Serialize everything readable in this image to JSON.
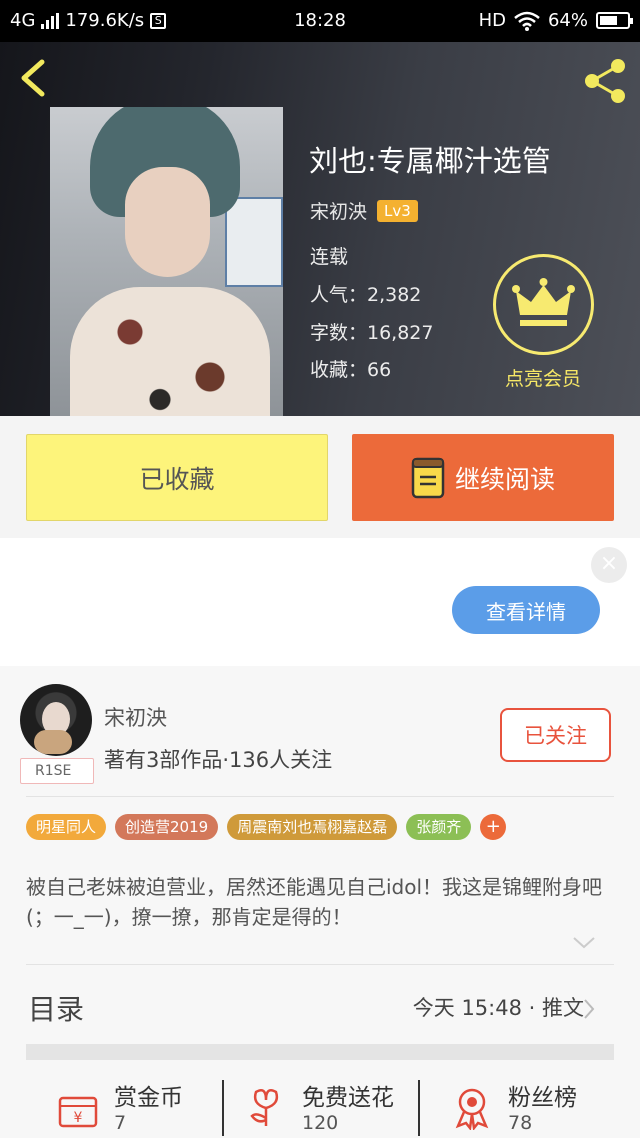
{
  "status_bar": {
    "network": "4G",
    "speed": "179.6K/s",
    "s_icon": "S",
    "time": "18:28",
    "hd": "HD",
    "battery": "64%",
    "battery_level": 0.64
  },
  "header": {
    "back_icon": "chevron-left-icon",
    "share_icon": "share-icon",
    "book_title": "刘也:专属椰汁选管",
    "author": "宋初泱",
    "level": "Lv3",
    "status": "连载",
    "popularity": "人气：2,382",
    "word_count": "字数：16,827",
    "favorites": "收藏：66",
    "vip_label": "点亮会员",
    "vip_icon": "crown-icon"
  },
  "buttons": {
    "favorite": "已收藏",
    "continue_read": "继续阅读",
    "read_icon": "book-icon"
  },
  "ad": {
    "close_label": "×",
    "detail_button": "查看详情"
  },
  "writer": {
    "name": "宋初泱",
    "badge": "R1SE",
    "stats": "著有3部作品·136人关注",
    "follow": "已关注"
  },
  "tags": [
    {
      "label": "明星同人",
      "color": "#f2a93b"
    },
    {
      "label": "创造营2019",
      "color": "#d3785a"
    },
    {
      "label": "周震南刘也焉栩嘉赵磊",
      "color": "#cf9a3a"
    },
    {
      "label": "张颜齐",
      "color": "#8cbf55"
    }
  ],
  "tag_more": "+",
  "summary": "被自己老妹被迫营业，居然还能遇见自己idol！我这是锦鲤附身吧(；一_一)，撩一撩，那肯定是得的！",
  "toc": {
    "title": "目录",
    "update": "今天 15:48 · 推文"
  },
  "actions": [
    {
      "label": "赏金币",
      "count": "7",
      "icon": "coin-gift-icon"
    },
    {
      "label": "免费送花",
      "count": "120",
      "icon": "flower-icon"
    },
    {
      "label": "粉丝榜",
      "count": "78",
      "icon": "ribbon-medal-icon"
    }
  ],
  "colors": {
    "accent_orange": "#ec6a3a",
    "fav_yellow": "#fdf47b",
    "crown_yellow": "#f7ea70",
    "follow_red": "#e8533d",
    "detail_blue": "#5b9de8"
  }
}
